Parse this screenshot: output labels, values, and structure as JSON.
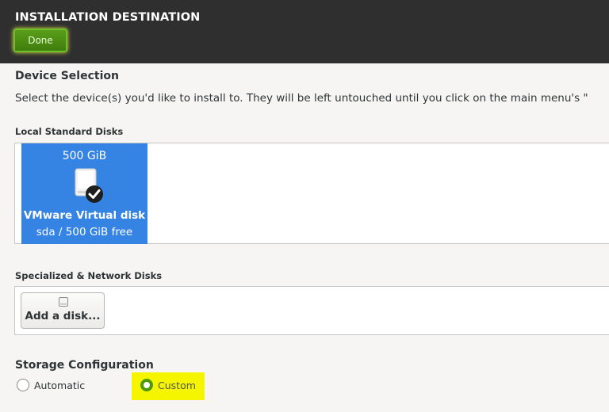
{
  "header": {
    "title": "INSTALLATION DESTINATION",
    "done_label": "Done"
  },
  "device_selection": {
    "title": "Device Selection",
    "description": "Select the device(s) you'd like to install to.  They will be left untouched until you click on the main menu's \""
  },
  "local_disks": {
    "label": "Local Standard Disks",
    "disks": [
      {
        "size": "500 GiB",
        "name": "VMware Virtual disk",
        "detail": "sda  /  500 GiB free",
        "selected": true
      }
    ]
  },
  "network_disks": {
    "label": "Specialized & Network Disks",
    "add_label": "Add a disk..."
  },
  "storage": {
    "title": "Storage Configuration",
    "options": [
      {
        "label": "Automatic",
        "checked": false
      },
      {
        "label": "Custom",
        "checked": true
      }
    ]
  },
  "colors": {
    "header_bg": "#2f2f2f",
    "done_green": "#4e9a06",
    "selection_blue": "#3584e4",
    "highlight_yellow": "#f5f500"
  },
  "icons": {
    "disk": "hard-disk-icon",
    "selected": "check-badge-icon",
    "add_disk": "disk-small-icon"
  }
}
